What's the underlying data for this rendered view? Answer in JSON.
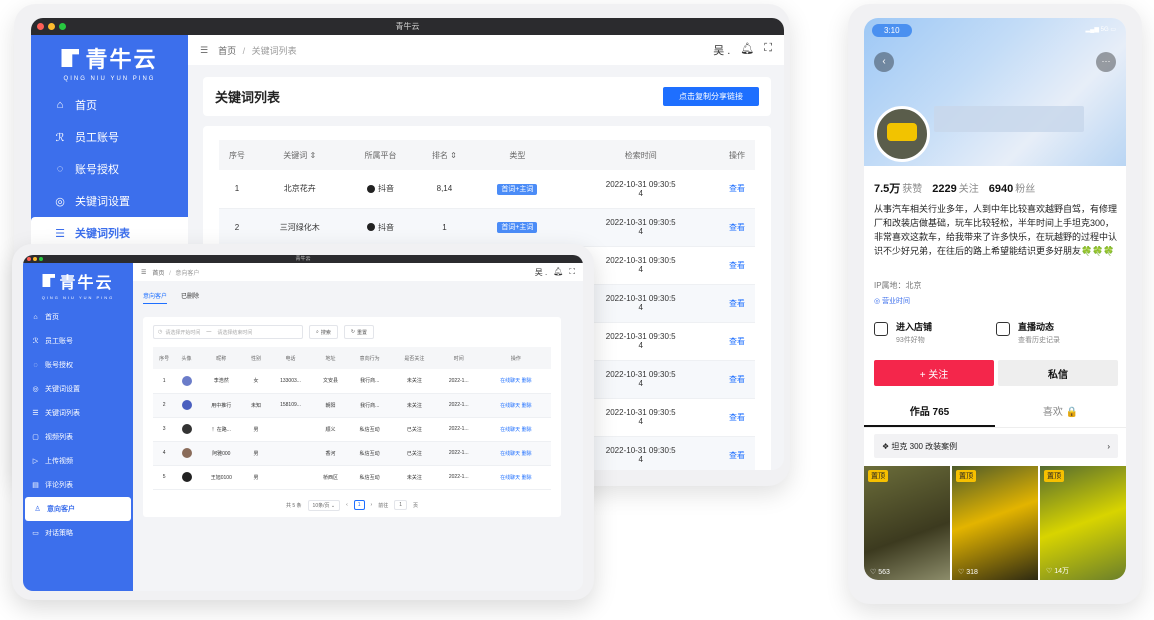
{
  "back_window": {
    "title": "青牛云",
    "logo": {
      "main": "青牛云",
      "sub": "QING NIU YUN PING"
    },
    "menu": [
      {
        "label": "首页",
        "icon": "home-icon",
        "glyph": "⌂",
        "active": false
      },
      {
        "label": "员工账号",
        "icon": "user-icon",
        "glyph": "ℛ",
        "active": false
      },
      {
        "label": "账号授权",
        "icon": "shield-icon",
        "glyph": "◌",
        "active": false
      },
      {
        "label": "关键词设置",
        "icon": "settings-icon",
        "glyph": "◎",
        "active": false
      },
      {
        "label": "关键词列表",
        "icon": "list-icon",
        "glyph": "☰",
        "active": true
      }
    ],
    "breadcrumb": {
      "home": "首页",
      "sep": "/",
      "current": "关键词列表"
    },
    "user_menu": "吴 .",
    "page_title": "关键词列表",
    "copy_button": "点击复制分享链接",
    "table": {
      "headers": [
        "序号",
        "关键词 ⇕",
        "所属平台",
        "排名 ⇕",
        "类型",
        "检索时间",
        "操作"
      ],
      "rows": [
        {
          "no": "1",
          "keyword": "北京花卉",
          "platform": "抖音",
          "rank": "8,14",
          "type": "首词+主词",
          "time_a": "2022-10-31 09:30:5",
          "time_b": "4",
          "action": "查看"
        },
        {
          "no": "2",
          "keyword": "三河绿化木",
          "platform": "抖音",
          "rank": "1",
          "type": "首词+主词",
          "time_a": "2022-10-31 09:30:5",
          "time_b": "4",
          "action": "查看"
        },
        {
          "no": "",
          "keyword": "",
          "platform": "",
          "rank": "",
          "type": "",
          "time_a": "2022-10-31 09:30:5",
          "time_b": "4",
          "action": "查看"
        },
        {
          "no": "",
          "keyword": "",
          "platform": "",
          "rank": "",
          "type": "",
          "time_a": "2022-10-31 09:30:5",
          "time_b": "4",
          "action": "查看"
        },
        {
          "no": "",
          "keyword": "",
          "platform": "",
          "rank": "",
          "type": "",
          "time_a": "2022-10-31 09:30:5",
          "time_b": "4",
          "action": "查看"
        },
        {
          "no": "",
          "keyword": "",
          "platform": "",
          "rank": "",
          "type": "",
          "time_a": "2022-10-31 09:30:5",
          "time_b": "4",
          "action": "查看"
        },
        {
          "no": "",
          "keyword": "",
          "platform": "",
          "rank": "",
          "type": "",
          "time_a": "2022-10-31 09:30:5",
          "time_b": "4",
          "action": "查看"
        },
        {
          "no": "",
          "keyword": "",
          "platform": "",
          "rank": "",
          "type": "",
          "time_a": "2022-10-31 09:30:5",
          "time_b": "4",
          "action": "查看"
        }
      ]
    }
  },
  "front_window": {
    "title": "青牛云",
    "logo": {
      "main": "青牛云",
      "sub": "QING NIU YUN PING"
    },
    "menu": [
      {
        "label": "首页",
        "glyph": "⌂",
        "active": false
      },
      {
        "label": "员工账号",
        "glyph": "ℛ",
        "active": false
      },
      {
        "label": "账号授权",
        "glyph": "◌",
        "active": false
      },
      {
        "label": "关键词设置",
        "glyph": "◎",
        "active": false
      },
      {
        "label": "关键词列表",
        "glyph": "☰",
        "active": false
      },
      {
        "label": "视频列表",
        "glyph": "▢",
        "active": false
      },
      {
        "label": "上传视频",
        "glyph": "▷",
        "active": false
      },
      {
        "label": "评论列表",
        "glyph": "▤",
        "active": false
      },
      {
        "label": "意向客户",
        "glyph": "♙",
        "active": true
      },
      {
        "label": "对话策略",
        "glyph": "▭",
        "active": false
      }
    ],
    "breadcrumb": {
      "home": "首页",
      "sep": "/",
      "current": "意向客户"
    },
    "user_menu": "吴 .",
    "tabs": [
      "意向客户",
      "已删除"
    ],
    "filter": {
      "start": "请选择开始时间",
      "dash": "—",
      "end": "请选择结束时间",
      "search": "搜索",
      "reset": "重置"
    },
    "table": {
      "headers": [
        "序号",
        "头像",
        "昵称",
        "性别",
        "电话",
        "地址",
        "意向行为",
        "是否关注",
        "时间",
        "操作"
      ],
      "rows": [
        {
          "no": "1",
          "avatar": "#6b7cc9",
          "nick": "李浩然",
          "sex": "女",
          "phone": "133003...",
          "addr": "文安县",
          "intent": "我行商...",
          "follow": "未关注",
          "time": "2022-1...",
          "act1": "在线聊天",
          "act2": "删除"
        },
        {
          "no": "2",
          "avatar": "#4a5fbf",
          "nick": "用中推行",
          "sex": "未知",
          "phone": "158109...",
          "addr": "朝阳",
          "intent": "我行商...",
          "follow": "未关注",
          "time": "2022-1...",
          "act1": "在线聊天",
          "act2": "删除"
        },
        {
          "no": "3",
          "avatar": "#333333",
          "nick": "！在路...",
          "sex": "男",
          "phone": "",
          "addr": "顺义",
          "intent": "私信互动",
          "follow": "已关注",
          "time": "2022-1...",
          "act1": "在线聊天",
          "act2": "删除"
        },
        {
          "no": "4",
          "avatar": "#8a6c5a",
          "nick": "阿雅000",
          "sex": "男",
          "phone": "",
          "addr": "香河",
          "intent": "私信互动",
          "follow": "已关注",
          "time": "2022-1...",
          "act1": "在线聊天",
          "act2": "删除"
        },
        {
          "no": "5",
          "avatar": "#222222",
          "nick": "王旭0100",
          "sex": "男",
          "phone": "",
          "addr": "桥西区",
          "intent": "私信互动",
          "follow": "未关注",
          "time": "2022-1...",
          "act1": "在线聊天",
          "act2": "删除"
        }
      ]
    },
    "pager": {
      "total": "共 5 条",
      "size": "10条/页 ⌄",
      "prev": "‹",
      "page": "1",
      "next": "›",
      "goto": "前往",
      "goto_val": "1",
      "unit": "页"
    }
  },
  "phone": {
    "time": "3:10",
    "signal": "5G",
    "back": "‹",
    "more": "···",
    "stats": [
      {
        "num": "7.5万",
        "label": "获赞"
      },
      {
        "num": "2229",
        "label": "关注"
      },
      {
        "num": "6940",
        "label": "粉丝"
      }
    ],
    "bio": "从事汽车相关行业多年，人到中年比较喜欢越野自驾，有修理厂和改装店做基础，玩车比较轻松，半年时间上手坦克300，非常喜欢这款车，给我带来了许多快乐，在玩越野的过程中认识不少好兄弟，在往后的路上希望能结识更多好朋友🍀🍀🍀",
    "ip": "IP属地：北京",
    "biz": "◎ 营业时间",
    "shop": {
      "title": "进入店铺",
      "sub": "93件好物"
    },
    "live": {
      "title": "直播动态",
      "sub": "查看历史记录"
    },
    "follow": "+ 关注",
    "message": "私信",
    "tabs": [
      "作品 765",
      "喜欢 🔒"
    ],
    "collection": "❖ 坦克 300 改装案例",
    "collection_arrow": "›",
    "thumbs": [
      {
        "pin": "置顶",
        "likes": "♡ 563"
      },
      {
        "pin": "置顶",
        "likes": "♡ 318"
      },
      {
        "pin": "置顶",
        "likes": "♡ 14万"
      }
    ]
  }
}
